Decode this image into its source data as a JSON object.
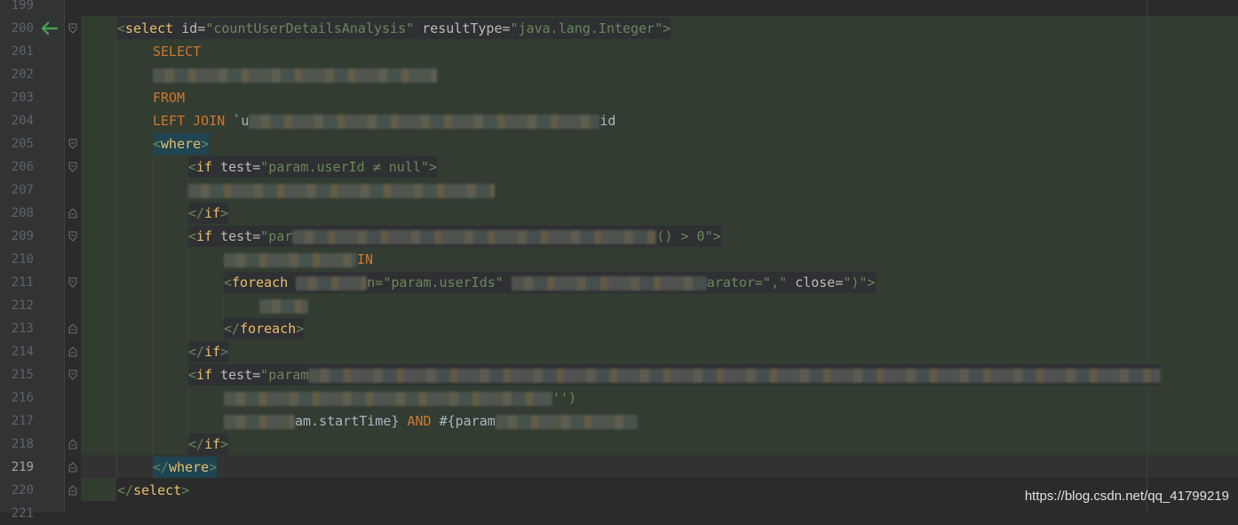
{
  "lines": [
    {
      "num": "199"
    },
    {
      "num": "200",
      "code": [
        {
          "t": "lt",
          "v": "<"
        },
        {
          "t": "tag",
          "v": "select "
        },
        {
          "t": "attr",
          "v": "id="
        },
        {
          "t": "str",
          "v": "\"countUserDetailsAnalysis\" "
        },
        {
          "t": "attr",
          "v": "resultType="
        },
        {
          "t": "str",
          "v": "\"java.lang.Integer\""
        },
        {
          "t": "lt",
          "v": ">"
        }
      ]
    },
    {
      "num": "201",
      "code": [
        {
          "t": "kw",
          "v": "SELECT"
        }
      ]
    },
    {
      "num": "202"
    },
    {
      "num": "203",
      "code": [
        {
          "t": "kw",
          "v": "FROM"
        }
      ]
    },
    {
      "num": "204",
      "code": [
        {
          "t": "kw",
          "v": "LEFT JOIN "
        },
        {
          "t": "plain",
          "v": "`u"
        },
        {
          "t": "blur",
          "v": ""
        },
        {
          "t": "plain",
          "v": "id"
        }
      ]
    },
    {
      "num": "205",
      "code": [
        {
          "t": "lt",
          "v": "<"
        },
        {
          "t": "tag",
          "v": "where"
        },
        {
          "t": "lt",
          "v": ">"
        }
      ]
    },
    {
      "num": "206",
      "code": [
        {
          "t": "lt",
          "v": "<"
        },
        {
          "t": "tag",
          "v": "if "
        },
        {
          "t": "attr",
          "v": "test="
        },
        {
          "t": "str",
          "v": "\"param.userId ≠ null\""
        },
        {
          "t": "lt",
          "v": ">"
        }
      ]
    },
    {
      "num": "207"
    },
    {
      "num": "208",
      "code": [
        {
          "t": "lt",
          "v": "</"
        },
        {
          "t": "tag",
          "v": "if"
        },
        {
          "t": "lt",
          "v": ">"
        }
      ]
    },
    {
      "num": "209",
      "code": [
        {
          "t": "lt",
          "v": "<"
        },
        {
          "t": "tag",
          "v": "if "
        },
        {
          "t": "attr",
          "v": "test="
        },
        {
          "t": "str",
          "v": "\"par"
        },
        {
          "t": "blur",
          "v": ""
        },
        {
          "t": "str",
          "v": "() > 0\""
        },
        {
          "t": "lt",
          "v": ">"
        }
      ]
    },
    {
      "num": "210",
      "code": [
        {
          "t": "blur",
          "v": ""
        },
        {
          "t": "kw",
          "v": "IN"
        }
      ]
    },
    {
      "num": "211",
      "code": [
        {
          "t": "lt",
          "v": "<"
        },
        {
          "t": "tag",
          "v": "foreach "
        },
        {
          "t": "blur",
          "v": ""
        },
        {
          "t": "str",
          "v": "n=\"param.userIds\" "
        },
        {
          "t": "blur",
          "v": ""
        },
        {
          "t": "str",
          "v": "arator=\",\" "
        },
        {
          "t": "attr",
          "v": "close="
        },
        {
          "t": "str",
          "v": "\")\""
        },
        {
          "t": "lt",
          "v": ">"
        }
      ]
    },
    {
      "num": "212"
    },
    {
      "num": "213",
      "code": [
        {
          "t": "lt",
          "v": "</"
        },
        {
          "t": "tag",
          "v": "foreach"
        },
        {
          "t": "lt",
          "v": ">"
        }
      ]
    },
    {
      "num": "214",
      "code": [
        {
          "t": "lt",
          "v": "</"
        },
        {
          "t": "tag",
          "v": "if"
        },
        {
          "t": "lt",
          "v": ">"
        }
      ]
    },
    {
      "num": "215",
      "code": [
        {
          "t": "lt",
          "v": "<"
        },
        {
          "t": "tag",
          "v": "if "
        },
        {
          "t": "attr",
          "v": "test="
        },
        {
          "t": "str",
          "v": "\"param"
        },
        {
          "t": "blur",
          "v": ""
        }
      ]
    },
    {
      "num": "216",
      "code": [
        {
          "t": "blur",
          "v": ""
        },
        {
          "t": "str",
          "v": "'')"
        }
      ]
    },
    {
      "num": "217",
      "code": [
        {
          "t": "blur",
          "v": ""
        },
        {
          "t": "plain",
          "v": "am.startTime} "
        },
        {
          "t": "kw",
          "v": "AND "
        },
        {
          "t": "plain",
          "v": "#{param"
        },
        {
          "t": "blur",
          "v": ""
        }
      ]
    },
    {
      "num": "218",
      "code": [
        {
          "t": "lt",
          "v": "</"
        },
        {
          "t": "tag",
          "v": "if"
        },
        {
          "t": "lt",
          "v": ">"
        }
      ]
    },
    {
      "num": "219",
      "code": [
        {
          "t": "lt",
          "v": "</"
        },
        {
          "t": "tag",
          "v": "where"
        },
        {
          "t": "lt",
          "v": ">"
        }
      ]
    },
    {
      "num": "220",
      "code": [
        {
          "t": "lt",
          "v": "</"
        },
        {
          "t": "tag",
          "v": "select"
        },
        {
          "t": "lt",
          "v": ">"
        }
      ]
    },
    {
      "num": "221"
    }
  ],
  "watermark": "https://blog.csdn.net/qq_41799219"
}
